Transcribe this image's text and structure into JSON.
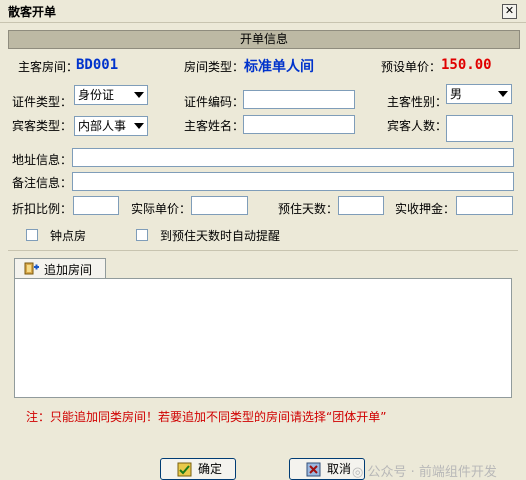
{
  "window": {
    "title": "散客开单",
    "close_glyph": "✕"
  },
  "section_title": "开单信息",
  "room": {
    "host_room_label": "主客房间：",
    "host_room_value": "BD001",
    "room_type_label": "房间类型：",
    "room_type_value": "标准单人间",
    "preset_price_label": "预设单价：",
    "preset_price_value": "150.00"
  },
  "form": {
    "id_type_label": "证件类型：",
    "id_type_value": "身份证",
    "id_number_label": "证件编码：",
    "id_number_value": "",
    "host_gender_label": "主客性别：",
    "host_gender_value": "男",
    "guest_type_label": "宾客类型：",
    "guest_type_value": "内部人事",
    "host_name_label": "主客姓名：",
    "host_name_value": "",
    "guest_count_label": "宾客人数：",
    "guest_count_value": "",
    "address_label": "地址信息：",
    "address_value": "",
    "remark_label": "备注信息：",
    "remark_value": "",
    "discount_label": "折扣比例：",
    "discount_value": "",
    "actual_price_label": "实际单价：",
    "actual_price_value": "",
    "days_label": "预住天数：",
    "days_value": "",
    "deposit_label": "实收押金：",
    "deposit_value": ""
  },
  "options": {
    "hourly_room_label": "钟点房",
    "auto_remind_label": "到预住天数时自动提醒"
  },
  "tab": {
    "label": "追加房间"
  },
  "note": "注：只能追加同类房间！若要追加不同类型的房间请选择“团体开单”",
  "buttons": {
    "ok_label": "确定",
    "cancel_label": "取消"
  },
  "watermark": "◎ 公众号 · 前端组件开发",
  "colors": {
    "accent_blue": "#0033cc",
    "price_red": "#e00000",
    "note_red": "#d00000",
    "header_bg": "#bdb9a4"
  }
}
